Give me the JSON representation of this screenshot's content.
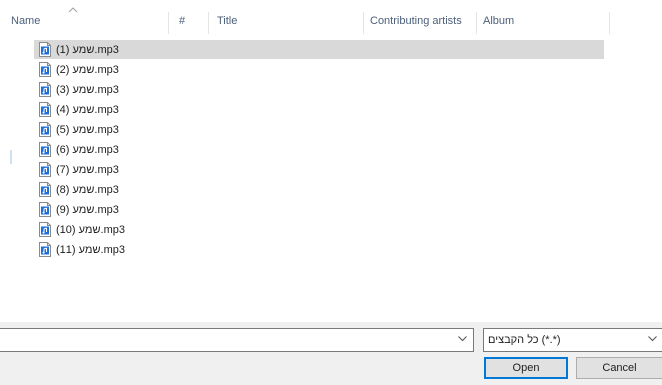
{
  "columns": {
    "name": "Name",
    "number": "#",
    "title": "Title",
    "contributing_artists": "Contributing artists",
    "album": "Album"
  },
  "files": [
    {
      "name": "שמע (1).mp3",
      "selected": true
    },
    {
      "name": "שמע (2).mp3",
      "selected": false
    },
    {
      "name": "שמע (3).mp3",
      "selected": false
    },
    {
      "name": "שמע (4).mp3",
      "selected": false
    },
    {
      "name": "שמע (5).mp3",
      "selected": false
    },
    {
      "name": "שמע (6).mp3",
      "selected": false
    },
    {
      "name": "שמע (7).mp3",
      "selected": false
    },
    {
      "name": "שמע (8).mp3",
      "selected": false
    },
    {
      "name": "שמע (9).mp3",
      "selected": false
    },
    {
      "name": "שמע (10).mp3",
      "selected": false
    },
    {
      "name": "שמע (11).mp3",
      "selected": false
    }
  ],
  "file_name_field": {
    "value": ""
  },
  "file_type_filter": {
    "selected": "כל הקבצים (*.*)"
  },
  "buttons": {
    "open": "Open",
    "cancel": "Cancel"
  },
  "icons": {
    "file": "audio-file-icon",
    "sort": "sort-caret-icon",
    "dropdown": "chevron-down-icon"
  },
  "colors": {
    "selection": "#d9d9d9",
    "header_text": "#4c607a",
    "focus_border": "#0078d7",
    "icon_blue": "#1e6fd9"
  }
}
